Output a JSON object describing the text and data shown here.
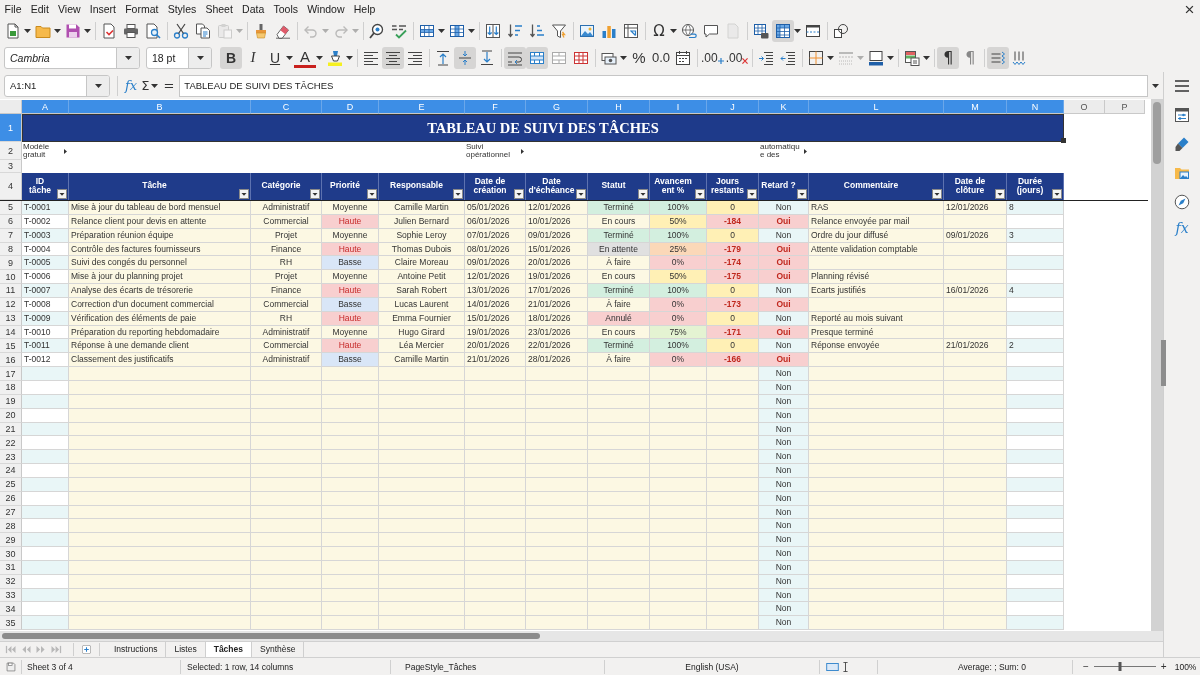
{
  "menu": [
    "File",
    "Edit",
    "View",
    "Insert",
    "Format",
    "Styles",
    "Sheet",
    "Data",
    "Tools",
    "Window",
    "Help"
  ],
  "standard_toolbar": {
    "paste": {
      "disabled": true
    },
    "undo": {
      "disabled": true
    },
    "redo": {
      "disabled": true
    },
    "special_character": {
      "label": "Ω"
    },
    "headers_footers": {
      "disabled": true
    },
    "freeze_rows_columns": {
      "on": true
    }
  },
  "formatting_toolbar": {
    "font_name": "Cambria",
    "font_size": "18 pt",
    "bold": {
      "label": "B",
      "on": true
    },
    "italic": {
      "label": "I",
      "on": false
    },
    "underline": {
      "label": "U",
      "on": false
    },
    "font_color": {
      "label": "A"
    },
    "align_left": {
      "on": false
    },
    "align_center": {
      "on": true
    },
    "align_right": {
      "on": false
    },
    "align_top": {
      "on": false
    },
    "align_middle": {
      "on": true
    },
    "align_bottom": {
      "on": false
    },
    "wrap_text": {
      "on": true
    },
    "merge_center": {
      "on": true
    },
    "merge_cells": {
      "on": false
    },
    "unmerge": {
      "on": false
    },
    "percent": {
      "label": "%"
    },
    "number_format": {
      "label": "0.0"
    },
    "add_decimal": {
      "label": ".00"
    },
    "delete_decimal": {
      "label": ".00"
    },
    "border_style": {
      "disabled": true
    },
    "left_to_right": {
      "label": "¶",
      "on": true
    },
    "right_to_left": {
      "label": "¶",
      "on": false
    },
    "text_horizontal": {
      "on": true
    },
    "text_vertical": {
      "on": false
    }
  },
  "formula_bar": {
    "name_box": "A1:N1",
    "function_wizard": "fx",
    "sum": "Σ",
    "equals": "=",
    "content": "TABLEAU DE SUIVI DES TÂCHES"
  },
  "sheet": {
    "columns": [
      {
        "label": "A",
        "selected": true
      },
      {
        "label": "B",
        "selected": true
      },
      {
        "label": "C",
        "selected": true
      },
      {
        "label": "D",
        "selected": true
      },
      {
        "label": "E",
        "selected": true
      },
      {
        "label": "F",
        "selected": true
      },
      {
        "label": "G",
        "selected": true
      },
      {
        "label": "H",
        "selected": true
      },
      {
        "label": "I",
        "selected": true
      },
      {
        "label": "J",
        "selected": true
      },
      {
        "label": "K",
        "selected": true
      },
      {
        "label": "L",
        "selected": true
      },
      {
        "label": "M",
        "selected": true
      },
      {
        "label": "N",
        "selected": true
      },
      {
        "label": "O",
        "selected": false
      },
      {
        "label": "P",
        "selected": false
      }
    ],
    "title_row": {
      "number": "1",
      "selected": true,
      "text": "TABLEAU DE SUIVI DES TÂCHES"
    },
    "note_row": {
      "number": "2",
      "selected": false,
      "template_note": "Modèle gratuit",
      "purpose_note": "Suivi opérationnel",
      "automation_note": "automatique des"
    },
    "blank_row": {
      "number": "3",
      "selected": false
    },
    "header_row": {
      "number": "4",
      "selected": false,
      "headers": [
        "ID tâche",
        "Tâche",
        "Catégorie",
        "Priorité",
        "Responsable",
        "Date de création",
        "Date d'échéance",
        "Statut",
        "Avancement %",
        "Jours restants",
        "Retard ?",
        "Commentaire",
        "Date de clôture",
        "Durée (jours)"
      ]
    },
    "rows": [
      {
        "number": "5",
        "selected": false,
        "id": "T-0001",
        "task": "Mise à jour du tableau de bord mensuel",
        "category": "Administratif",
        "priority": {
          "text": "Moyenne",
          "color": "#fcf8e3",
          "alert": false
        },
        "owner": "Camille Martin",
        "created": "05/01/2026",
        "due": "12/01/2026",
        "status": {
          "text": "Terminé",
          "color": "#d3efdf"
        },
        "progress": {
          "text": "100%",
          "color": "#d3efdf"
        },
        "days_left": {
          "text": "0",
          "color": "#fff0b5",
          "alert": false
        },
        "late": {
          "text": "Non",
          "color": "#e9f6f7",
          "alert": false
        },
        "comment": "RAS",
        "closed": "12/01/2026",
        "duration": "8"
      },
      {
        "number": "6",
        "selected": false,
        "id": "T-0002",
        "task": "Relance client pour devis en attente",
        "category": "Commercial",
        "priority": {
          "text": "Haute",
          "color": "#f8cfcf",
          "alert": true
        },
        "owner": "Julien Bernard",
        "created": "06/01/2026",
        "due": "10/01/2026",
        "status": {
          "text": "En cours",
          "color": "#fcf8e3"
        },
        "progress": {
          "text": "50%",
          "color": "#fff0b5"
        },
        "days_left": {
          "text": "-184",
          "color": "#f8cfcf",
          "alert": true
        },
        "late": {
          "text": "Oui",
          "color": "#f8cfcf",
          "alert": true
        },
        "comment": "Relance envoyée par mail"
      },
      {
        "number": "7",
        "selected": false,
        "id": "T-0003",
        "task": "Préparation réunion équipe",
        "category": "Projet",
        "priority": {
          "text": "Moyenne",
          "color": "#fcf8e3",
          "alert": false
        },
        "owner": "Sophie Leroy",
        "created": "07/01/2026",
        "due": "09/01/2026",
        "status": {
          "text": "Terminé",
          "color": "#d3efdf"
        },
        "progress": {
          "text": "100%",
          "color": "#d3efdf"
        },
        "days_left": {
          "text": "0",
          "color": "#fff0b5",
          "alert": false
        },
        "late": {
          "text": "Non",
          "color": "#e9f6f7",
          "alert": false
        },
        "comment": "Ordre du jour diffusé",
        "closed": "09/01/2026",
        "duration": "3"
      },
      {
        "number": "8",
        "selected": false,
        "id": "T-0004",
        "task": "Contrôle des factures fournisseurs",
        "category": "Finance",
        "priority": {
          "text": "Haute",
          "color": "#f8cfcf",
          "alert": true
        },
        "owner": "Thomas Dubois",
        "created": "08/01/2026",
        "due": "15/01/2026",
        "status": {
          "text": "En attente",
          "color": "#e0e0e0"
        },
        "progress": {
          "text": "25%",
          "color": "#fbd8b8"
        },
        "days_left": {
          "text": "-179",
          "color": "#f8cfcf",
          "alert": true
        },
        "late": {
          "text": "Oui",
          "color": "#f8cfcf",
          "alert": true
        },
        "comment": "Attente validation comptable"
      },
      {
        "number": "9",
        "selected": false,
        "id": "T-0005",
        "task": "Suivi des congés du personnel",
        "category": "RH",
        "priority": {
          "text": "Basse",
          "color": "#d9e6f7",
          "alert": false
        },
        "owner": "Claire Moreau",
        "created": "09/01/2026",
        "due": "20/01/2026",
        "status": {
          "text": "À faire",
          "color": "#fcf8e3"
        },
        "progress": {
          "text": "0%",
          "color": "#f8cfcf"
        },
        "days_left": {
          "text": "-174",
          "color": "#f8cfcf",
          "alert": true
        },
        "late": {
          "text": "Oui",
          "color": "#f8cfcf",
          "alert": true
        }
      },
      {
        "number": "10",
        "selected": false,
        "id": "T-0006",
        "task": "Mise à jour du planning projet",
        "category": "Projet",
        "priority": {
          "text": "Moyenne",
          "color": "#fcf8e3",
          "alert": false
        },
        "owner": "Antoine Petit",
        "created": "12/01/2026",
        "due": "19/01/2026",
        "status": {
          "text": "En cours",
          "color": "#fcf8e3"
        },
        "progress": {
          "text": "50%",
          "color": "#fff0b5"
        },
        "days_left": {
          "text": "-175",
          "color": "#f8cfcf",
          "alert": true
        },
        "late": {
          "text": "Oui",
          "color": "#f8cfcf",
          "alert": true
        },
        "comment": "Planning révisé"
      },
      {
        "number": "11",
        "selected": false,
        "id": "T-0007",
        "task": "Analyse des écarts de trésorerie",
        "category": "Finance",
        "priority": {
          "text": "Haute",
          "color": "#f8cfcf",
          "alert": true
        },
        "owner": "Sarah Robert",
        "created": "13/01/2026",
        "due": "17/01/2026",
        "status": {
          "text": "Terminé",
          "color": "#d3efdf"
        },
        "progress": {
          "text": "100%",
          "color": "#d3efdf"
        },
        "days_left": {
          "text": "0",
          "color": "#fff0b5",
          "alert": false
        },
        "late": {
          "text": "Non",
          "color": "#e9f6f7",
          "alert": false
        },
        "comment": "Ecarts justifiés",
        "closed": "16/01/2026",
        "duration": "4"
      },
      {
        "number": "12",
        "selected": false,
        "id": "T-0008",
        "task": "Correction d'un document commercial",
        "category": "Commercial",
        "priority": {
          "text": "Basse",
          "color": "#d9e6f7",
          "alert": false
        },
        "owner": "Lucas Laurent",
        "created": "14/01/2026",
        "due": "21/01/2026",
        "status": {
          "text": "À faire",
          "color": "#fcf8e3"
        },
        "progress": {
          "text": "0%",
          "color": "#f8cfcf"
        },
        "days_left": {
          "text": "-173",
          "color": "#f8cfcf",
          "alert": true
        },
        "late": {
          "text": "Oui",
          "color": "#f8cfcf",
          "alert": true
        }
      },
      {
        "number": "13",
        "selected": false,
        "id": "T-0009",
        "task": "Vérification des éléments de paie",
        "category": "RH",
        "priority": {
          "text": "Haute",
          "color": "#f8cfcf",
          "alert": true
        },
        "owner": "Emma Fournier",
        "created": "15/01/2026",
        "due": "18/01/2026",
        "status": {
          "text": "Annulé",
          "color": "#f8cfcf"
        },
        "progress": {
          "text": "0%",
          "color": "#f8cfcf"
        },
        "days_left": {
          "text": "0",
          "color": "#fff0b5",
          "alert": false
        },
        "late": {
          "text": "Non",
          "color": "#e9f6f7",
          "alert": false
        },
        "comment": "Reporté au mois suivant"
      },
      {
        "number": "14",
        "selected": false,
        "id": "T-0010",
        "task": "Préparation du reporting hebdomadaire",
        "category": "Administratif",
        "priority": {
          "text": "Moyenne",
          "color": "#fcf8e3",
          "alert": false
        },
        "owner": "Hugo Girard",
        "created": "19/01/2026",
        "due": "23/01/2026",
        "status": {
          "text": "En cours",
          "color": "#fcf8e3"
        },
        "progress": {
          "text": "75%",
          "color": "#e4f3d2"
        },
        "days_left": {
          "text": "-171",
          "color": "#f8cfcf",
          "alert": true
        },
        "late": {
          "text": "Oui",
          "color": "#f8cfcf",
          "alert": true
        },
        "comment": "Presque terminé"
      },
      {
        "number": "15",
        "selected": false,
        "id": "T-0011",
        "task": "Réponse à une demande client",
        "category": "Commercial",
        "priority": {
          "text": "Haute",
          "color": "#f8cfcf",
          "alert": true
        },
        "owner": "Léa Mercier",
        "created": "20/01/2026",
        "due": "22/01/2026",
        "status": {
          "text": "Terminé",
          "color": "#d3efdf"
        },
        "progress": {
          "text": "100%",
          "color": "#d3efdf"
        },
        "days_left": {
          "text": "0",
          "color": "#fff0b5",
          "alert": false
        },
        "late": {
          "text": "Non",
          "color": "#e9f6f7",
          "alert": false
        },
        "comment": "Réponse envoyée",
        "closed": "21/01/2026",
        "duration": "2"
      },
      {
        "number": "16",
        "selected": false,
        "id": "T-0012",
        "task": "Classement des justificatifs",
        "category": "Administratif",
        "priority": {
          "text": "Basse",
          "color": "#d9e6f7",
          "alert": false
        },
        "owner": "Camille Martin",
        "created": "21/01/2026",
        "due": "28/01/2026",
        "status": {
          "text": "À faire",
          "color": "#fcf8e3"
        },
        "progress": {
          "text": "0%",
          "color": "#f8cfcf"
        },
        "days_left": {
          "text": "-166",
          "color": "#f8cfcf",
          "alert": true
        },
        "late": {
          "text": "Oui",
          "color": "#f8cfcf",
          "alert": true
        }
      },
      {
        "number": "17",
        "selected": false,
        "late": {
          "text": "Non",
          "color": "#e9f6f7",
          "alert": false
        }
      },
      {
        "number": "18",
        "selected": false,
        "late": {
          "text": "Non",
          "color": "#e9f6f7",
          "alert": false
        }
      },
      {
        "number": "19",
        "selected": false,
        "late": {
          "text": "Non",
          "color": "#e9f6f7",
          "alert": false
        }
      },
      {
        "number": "20",
        "selected": false,
        "late": {
          "text": "Non",
          "color": "#e9f6f7",
          "alert": false
        }
      },
      {
        "number": "21",
        "selected": false,
        "late": {
          "text": "Non",
          "color": "#e9f6f7",
          "alert": false
        }
      },
      {
        "number": "22",
        "selected": false,
        "late": {
          "text": "Non",
          "color": "#e9f6f7",
          "alert": false
        }
      },
      {
        "number": "23",
        "selected": false,
        "late": {
          "text": "Non",
          "color": "#e9f6f7",
          "alert": false
        }
      },
      {
        "number": "24",
        "selected": false,
        "late": {
          "text": "Non",
          "color": "#e9f6f7",
          "alert": false
        }
      },
      {
        "number": "25",
        "selected": false,
        "late": {
          "text": "Non",
          "color": "#e9f6f7",
          "alert": false
        }
      },
      {
        "number": "26",
        "selected": false,
        "late": {
          "text": "Non",
          "color": "#e9f6f7",
          "alert": false
        }
      },
      {
        "number": "27",
        "selected": false,
        "late": {
          "text": "Non",
          "color": "#e9f6f7",
          "alert": false
        }
      },
      {
        "number": "28",
        "selected": false,
        "late": {
          "text": "Non",
          "color": "#e9f6f7",
          "alert": false
        }
      },
      {
        "number": "29",
        "selected": false,
        "late": {
          "text": "Non",
          "color": "#e9f6f7",
          "alert": false
        }
      },
      {
        "number": "30",
        "selected": false,
        "late": {
          "text": "Non",
          "color": "#e9f6f7",
          "alert": false
        }
      },
      {
        "number": "31",
        "selected": false,
        "late": {
          "text": "Non",
          "color": "#e9f6f7",
          "alert": false
        }
      },
      {
        "number": "32",
        "selected": false,
        "late": {
          "text": "Non",
          "color": "#e9f6f7",
          "alert": false
        }
      },
      {
        "number": "33",
        "selected": false,
        "late": {
          "text": "Non",
          "color": "#e9f6f7",
          "alert": false
        }
      },
      {
        "number": "34",
        "selected": false,
        "late": {
          "text": "Non",
          "color": "#e9f6f7",
          "alert": false
        }
      },
      {
        "number": "35",
        "selected": false,
        "late": {
          "text": "Non",
          "color": "#e9f6f7",
          "alert": false
        }
      }
    ]
  },
  "sidebar": {
    "functions": "fx"
  },
  "sheet_tabs": [
    {
      "label": "Instructions",
      "selected": false
    },
    {
      "label": "Listes",
      "selected": false
    },
    {
      "label": "Tâches",
      "selected": true
    },
    {
      "label": "Synthèse",
      "selected": false
    }
  ],
  "status_bar": {
    "sheet": "Sheet 3 of 4",
    "selection": "Selected: 1 row, 14 columns",
    "page_style": "PageStyle_Tâches",
    "language": "English (USA)",
    "summary": "Average: ; Sum: 0",
    "zoom_out": "−",
    "zoom": {
      "level": 0.42
    },
    "zoom_in": "+",
    "zoom_percent": "100%"
  }
}
